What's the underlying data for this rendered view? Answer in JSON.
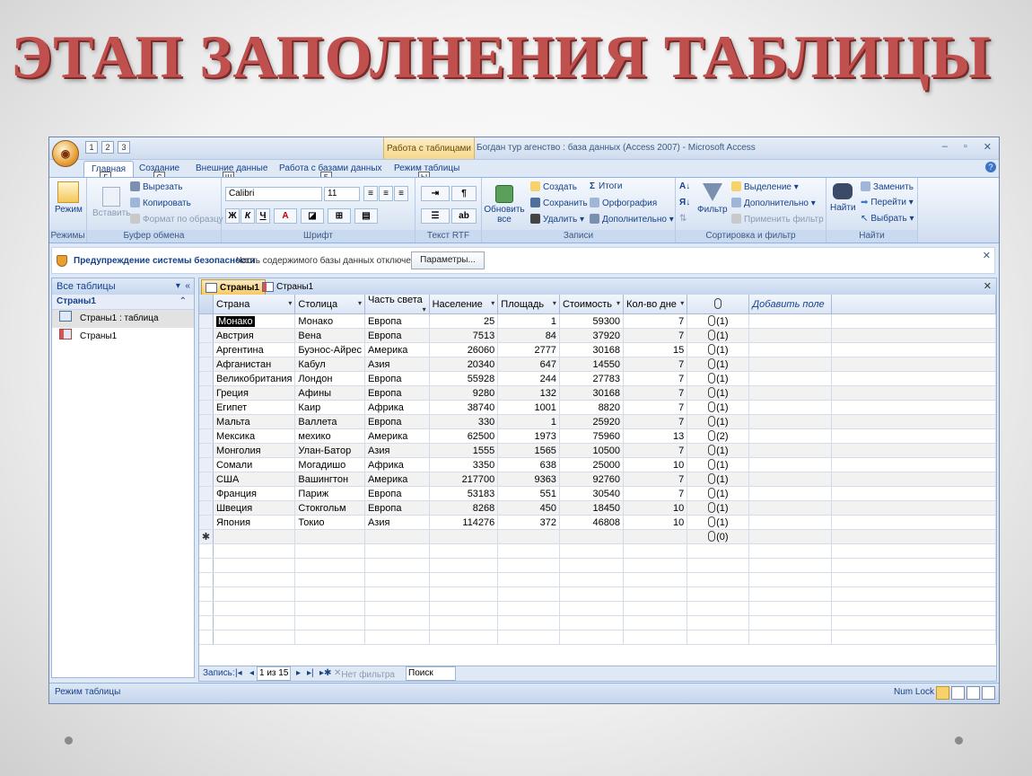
{
  "slide": {
    "title": "ЭТАП ЗАПОЛНЕНИЯ ТАБЛИЦЫ",
    "title_color": "#c0504d"
  },
  "titlebar": {
    "context_tab": "Работа с таблицами",
    "app_title": "Богдан тур агенство : база данных (Access 2007) - Microsoft Access",
    "qat_keytips": [
      "1",
      "2",
      "3"
    ],
    "window_controls": [
      "–",
      "▫",
      "✕"
    ]
  },
  "ribbon_tabs": [
    {
      "label": "Главная",
      "keytip": "Г",
      "active": true
    },
    {
      "label": "Создание",
      "keytip": "С"
    },
    {
      "label": "Внешние данные",
      "keytip": "Ш"
    },
    {
      "label": "Работа с базами данных",
      "keytip": "Б"
    },
    {
      "label": "Режим таблицы",
      "keytip": "Ы"
    }
  ],
  "ribbon": {
    "views": {
      "label": "Режимы",
      "mode_button": "Режим"
    },
    "clipboard": {
      "label": "Буфер обмена",
      "paste": "Вставить",
      "cut": "Вырезать",
      "copy": "Копировать",
      "format_painter": "Формат по образцу"
    },
    "font": {
      "label": "Шрифт",
      "font_name": "Calibri",
      "font_size": "11",
      "bold": "Ж",
      "italic": "К",
      "underline": "Ч",
      "font_color": "A"
    },
    "rtf": {
      "label": "Текст RTF"
    },
    "records": {
      "label": "Записи",
      "refresh": "Обновить все",
      "new": "Создать",
      "save": "Сохранить",
      "delete": "Удалить",
      "totals": "Итоги",
      "spelling": "Орфография",
      "more": "Дополнительно"
    },
    "sort_filter": {
      "label": "Сортировка и фильтр",
      "filter": "Фильтр",
      "selection": "Выделение",
      "advanced": "Дополнительно",
      "apply_filter": "Применить фильтр"
    },
    "find": {
      "label": "Найти",
      "find": "Найти",
      "replace": "Заменить",
      "goto": "Перейти",
      "select": "Выбрать"
    }
  },
  "security_bar": {
    "title": "Предупреждение системы безопасности",
    "message": "Часть содержимого базы данных отключено",
    "button": "Параметры..."
  },
  "nav_pane": {
    "header": "Все таблицы",
    "group": "Страны1",
    "items": [
      {
        "label": "Страны1 : таблица",
        "type": "table",
        "selected": true
      },
      {
        "label": "Страны1",
        "type": "form"
      }
    ]
  },
  "doc_tabs": [
    {
      "label": "Страны1",
      "active": true
    },
    {
      "label": "Страны1",
      "active": false
    }
  ],
  "datasheet": {
    "columns": [
      "Страна",
      "Столица",
      "Часть света",
      "Население",
      "Площадь",
      "Стоимость",
      "Кол-во дне",
      "",
      "Добавить поле"
    ],
    "rows": [
      [
        "Монако",
        "Монако",
        "Европа",
        "25",
        "1",
        "59300",
        "7",
        "(1)"
      ],
      [
        "Австрия",
        "Вена",
        "Европа",
        "7513",
        "84",
        "37920",
        "7",
        "(1)"
      ],
      [
        "Аргентина",
        "Буэнос-Айрес",
        "Америка",
        "26060",
        "2777",
        "30168",
        "15",
        "(1)"
      ],
      [
        "Афганистан",
        "Кабул",
        "Азия",
        "20340",
        "647",
        "14550",
        "7",
        "(1)"
      ],
      [
        "Великобритания",
        "Лондон",
        "Европа",
        "55928",
        "244",
        "27783",
        "7",
        "(1)"
      ],
      [
        "Греция",
        "Афины",
        "Европа",
        "9280",
        "132",
        "30168",
        "7",
        "(1)"
      ],
      [
        "Египет",
        "Каир",
        "Африка",
        "38740",
        "1001",
        "8820",
        "7",
        "(1)"
      ],
      [
        "Мальта",
        "Валлета",
        "Европа",
        "330",
        "1",
        "25920",
        "7",
        "(1)"
      ],
      [
        "Мексика",
        " мехико",
        "Америка",
        "62500",
        "1973",
        "75960",
        "13",
        "(2)"
      ],
      [
        "Монголия",
        "Улан-Батор",
        "Азия",
        "1555",
        "1565",
        "10500",
        "7",
        "(1)"
      ],
      [
        "Сомали",
        "Могадишо",
        "Африка",
        "3350",
        "638",
        "25000",
        "10",
        "(1)"
      ],
      [
        "США",
        "Вашингтон",
        "Америка",
        "217700",
        "9363",
        "92760",
        "7",
        "(1)"
      ],
      [
        "Франция",
        "Париж",
        "Европа",
        "53183",
        "551",
        "30540",
        "7",
        "(1)"
      ],
      [
        "Швеция",
        "Стокгольм",
        "Европа",
        "8268",
        "450",
        "18450",
        "10",
        "(1)"
      ],
      [
        "Япония",
        "Токио",
        "Азия",
        "114276",
        "372",
        "46808",
        "10",
        "(1)"
      ]
    ],
    "new_row_marker": "✱",
    "new_row_attachments": "(0)"
  },
  "record_nav": {
    "label": "Запись:",
    "position": "1 из 15",
    "filter": "Нет фильтра",
    "search": "Поиск"
  },
  "statusbar": {
    "mode": "Режим таблицы",
    "numlock": "Num Lock"
  }
}
